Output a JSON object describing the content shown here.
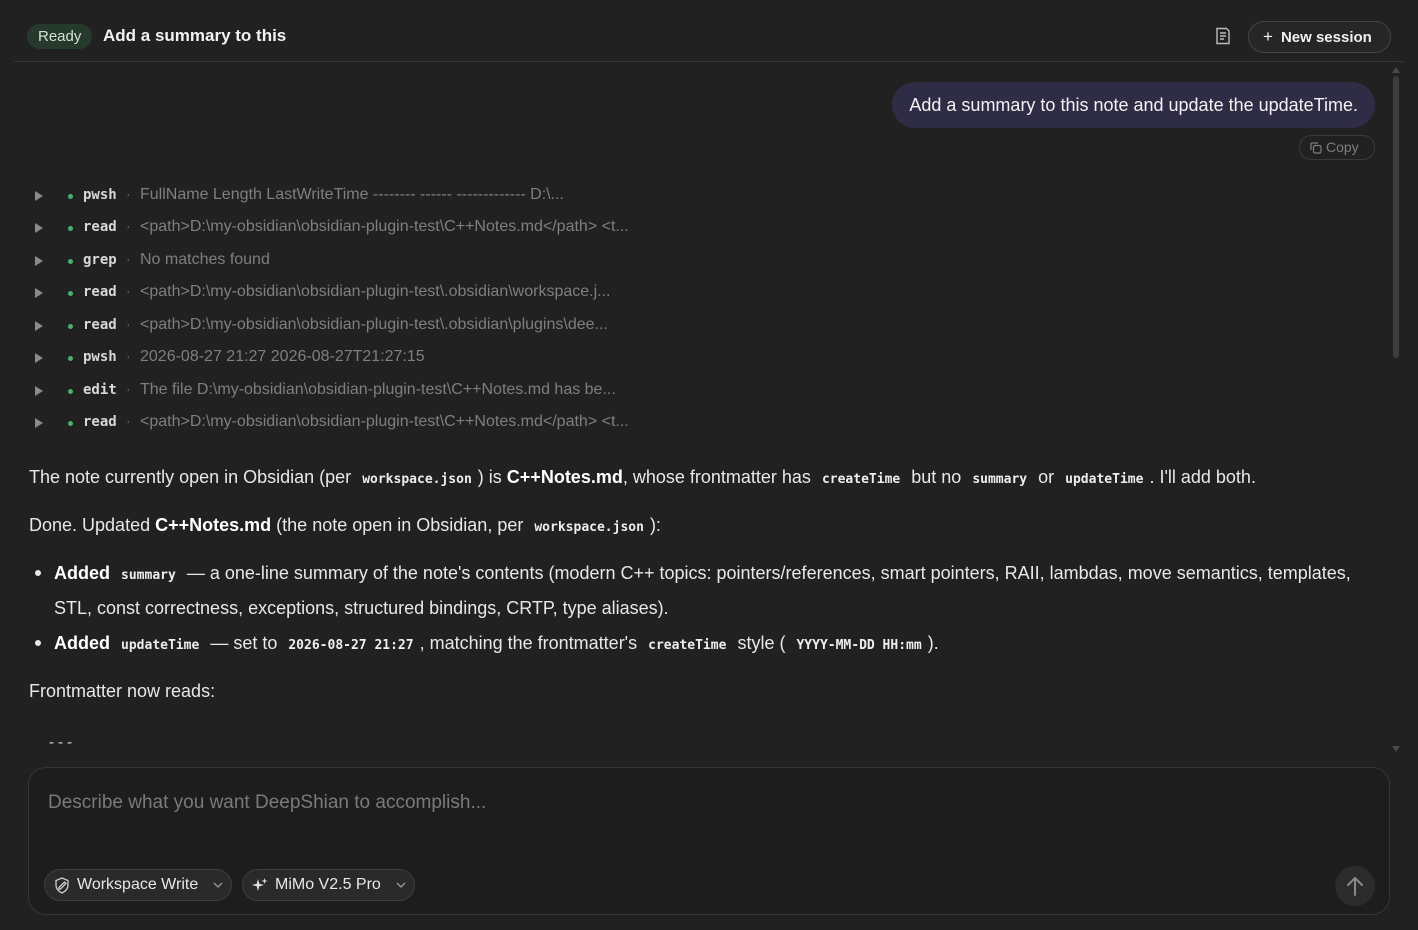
{
  "header": {
    "status": "Ready",
    "title": "Add a summary to this",
    "new_session_label": "New session",
    "notes_icon": "notes-icon"
  },
  "user_message": {
    "text": "Add a summary to this note and update the updateTime.",
    "copy_label": "Copy"
  },
  "tool_calls": [
    {
      "name": "pwsh",
      "output": "FullName Length LastWriteTime -------- ------ ------------- D:\\..."
    },
    {
      "name": "read",
      "output": "<path>D:\\my-obsidian\\obsidian-plugin-test\\C++Notes.md</path> <t..."
    },
    {
      "name": "grep",
      "output": "No matches found"
    },
    {
      "name": "read",
      "output": "<path>D:\\my-obsidian\\obsidian-plugin-test\\.obsidian\\workspace.j..."
    },
    {
      "name": "read",
      "output": "<path>D:\\my-obsidian\\obsidian-plugin-test\\.obsidian\\plugins\\dee..."
    },
    {
      "name": "pwsh",
      "output": "2026-08-27 21:27 2026-08-27T21:27:15"
    },
    {
      "name": "edit",
      "output": "The file D:\\my-obsidian\\obsidian-plugin-test\\C++Notes.md has be..."
    },
    {
      "name": "read",
      "output": "<path>D:\\my-obsidian\\obsidian-plugin-test\\C++Notes.md</path> <t..."
    }
  ],
  "response": {
    "p1": {
      "a": "The note currently open in Obsidian (per",
      "code1": "workspace.json",
      "b": ") is",
      "strong": "C++Notes.md",
      "c": ", whose frontmatter has",
      "code2": "createTime",
      "d": "but no",
      "code3": "summary",
      "e": "or",
      "code4": "updateTime",
      "f": ". I'll add both."
    },
    "p2": {
      "a": "Done. Updated",
      "strong": "C++Notes.md",
      "b": "(the note open in Obsidian, per",
      "code1": "workspace.json",
      "c": "):"
    },
    "bullet1": {
      "strong": "Added",
      "code": "summary",
      "text": "— a one-line summary of the note's contents (modern C++ topics: pointers/references, smart pointers, RAII, lambdas, move semantics, templates, STL, const correctness, exceptions, structured bindings, CRTP, type aliases)."
    },
    "bullet2": {
      "strong": "Added",
      "code1": "updateTime",
      "a": "— set to",
      "code2": "2026-08-27 21:27",
      "b": ", matching the frontmatter's",
      "code3": "createTime",
      "c": "style (",
      "code4": "YYYY-MM-DD HH:mm",
      "d": ")."
    },
    "p3": "Frontmatter now reads:",
    "frontmatter_delim": "---"
  },
  "composer": {
    "placeholder": "Describe what you want DeepShian to accomplish...",
    "mode_label": "Workspace Write",
    "model_label": "MiMo V2.5 Pro"
  },
  "colors": {
    "background": "#212121",
    "status_pill": "#26392d",
    "user_bubble": "#2f2d45",
    "tool_dot": "#4cae6a"
  }
}
